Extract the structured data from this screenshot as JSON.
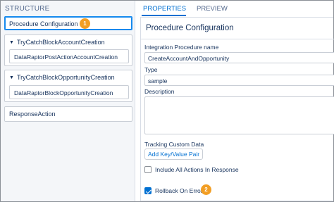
{
  "structure": {
    "title": "STRUCTURE",
    "selected_item": {
      "label": "Procedure Configuration",
      "badge": "1"
    },
    "groups": [
      {
        "label": "TryCatchBlockAccountCreation",
        "child": "DataRaptorPostActionAccountCreation"
      },
      {
        "label": "TryCatchBlockOpportunityCreation",
        "child": "DataRaptorBlockOpportunityCreation"
      }
    ],
    "last_item": "ResponseAction"
  },
  "tabs": [
    {
      "label": "PROPERTIES",
      "active": true
    },
    {
      "label": "PREVIEW",
      "active": false
    }
  ],
  "properties": {
    "heading": "Procedure Configuration",
    "integration_procedure_name": {
      "label": "Integration Procedure name",
      "value": "CreateAccountAndOpportunity"
    },
    "type": {
      "label": "Type",
      "value": "sample"
    },
    "description": {
      "label": "Description",
      "value": ""
    },
    "tracking": {
      "label": "Tracking Custom Data",
      "button": "Add Key/Value Pair"
    },
    "include_all_actions": {
      "label": "Include All Actions In Response",
      "checked": false
    },
    "rollback_on_error": {
      "label": "Rollback On Error",
      "checked": true,
      "badge": "2"
    }
  },
  "colors": {
    "accent": "#0070d2",
    "badge": "#f29e24",
    "panel_bg": "#f4f6f9"
  }
}
